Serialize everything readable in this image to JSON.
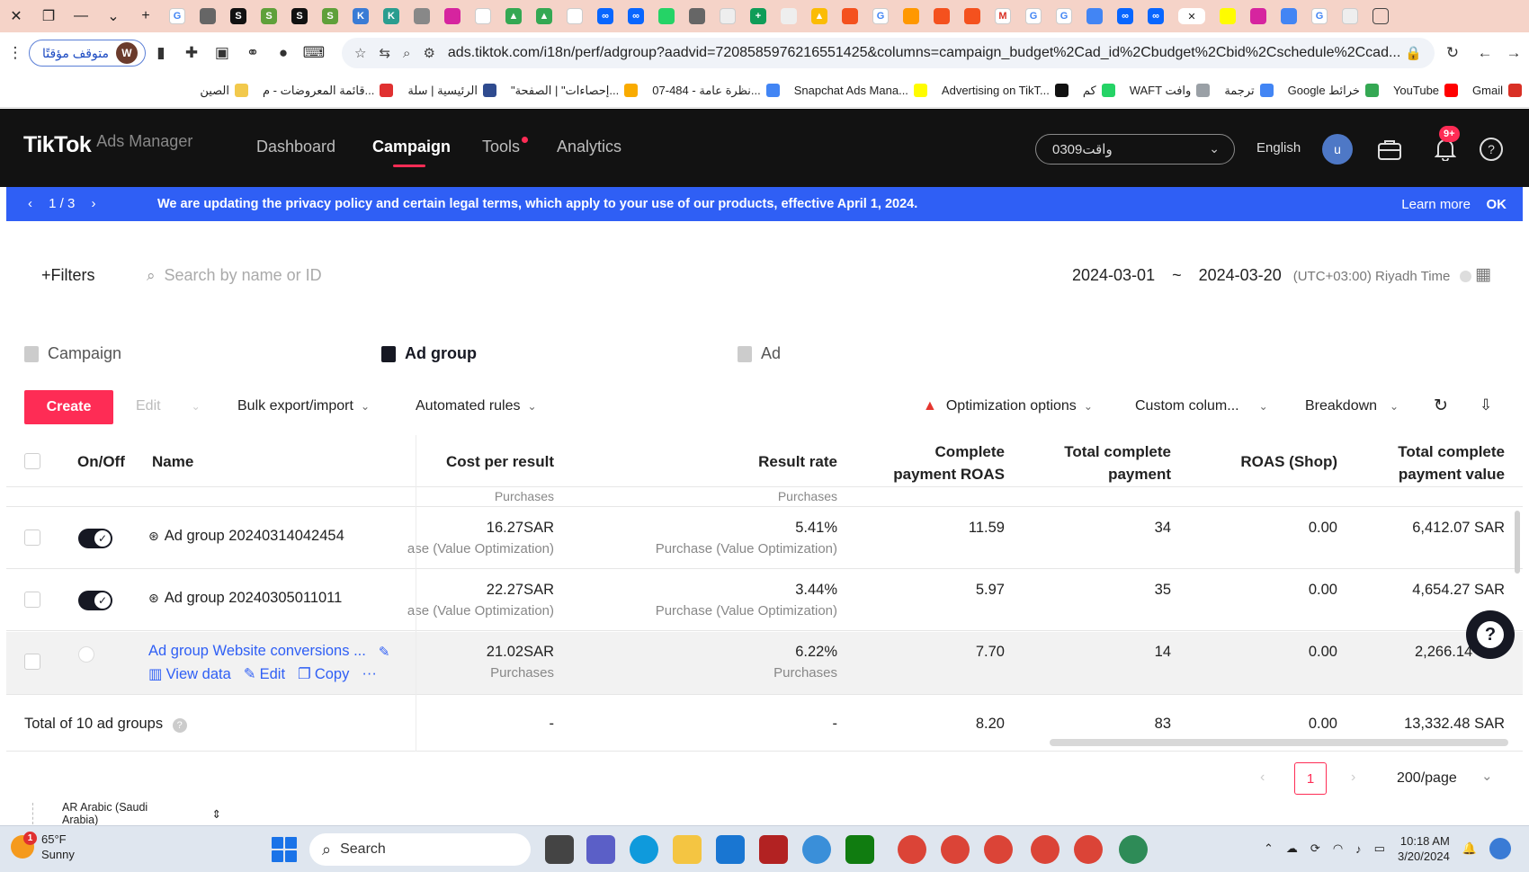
{
  "browser": {
    "window_close": "✕",
    "profile_paused_label": "متوقف مؤقتًا",
    "profile_initial": "W",
    "url": "ads.tiktok.com/i18n/perf/adgroup?aadvid=7208585976216551425&columns=campaign_budget%2Cad_id%2Cbudget%2Cbid%2Cschedule%2Ccad...",
    "bookmarks": [
      {
        "label": "Gmail",
        "icon": "gmail-icon",
        "color": "#d93025"
      },
      {
        "label": "YouTube",
        "icon": "youtube-icon",
        "color": "#ff0000"
      },
      {
        "label": "Google خرائط",
        "icon": "maps-icon",
        "color": "#34a853"
      },
      {
        "label": "ترجمة",
        "icon": "translate-icon",
        "color": "#4285f4"
      },
      {
        "label": "WAFT وافت",
        "icon": "waft-icon",
        "color": "#9aa0a6"
      },
      {
        "label": "كم",
        "icon": "whatsapp-icon",
        "color": "#25d366"
      },
      {
        "label": "Advertising on TikT...",
        "icon": "tiktok-icon",
        "color": "#111111"
      },
      {
        "label": "Snapchat Ads Mana...",
        "icon": "snapchat-icon",
        "color": "#fffc00"
      },
      {
        "label": "نظرة عامة - 484-07...",
        "icon": "google-icon",
        "color": "#4285f4"
      },
      {
        "label": "\"إحصاءات\" | الصفحة...",
        "icon": "analytics-icon",
        "color": "#f9ab00"
      },
      {
        "label": "الرئيسية | سلة",
        "icon": "salla-icon",
        "color": "#2f4b8f"
      },
      {
        "label": "قائمة المعروضات - م...",
        "icon": "flower-icon",
        "color": "#e03030"
      },
      {
        "label": "الصين",
        "icon": "folder-icon",
        "color": "#f2c94c"
      }
    ]
  },
  "header": {
    "logo": "TikTok",
    "logo_sub": "Ads Manager",
    "nav": [
      "Dashboard",
      "Campaign",
      "Tools",
      "Analytics"
    ],
    "account": "واقت0309",
    "language": "English",
    "avatar_initial": "u",
    "notification_badge": "9+"
  },
  "announcement": {
    "pager": "1  /  3",
    "message": "We are updating the privacy policy and certain legal terms, which apply to your use of our products, effective April 1, 2024.",
    "learn_more": "Learn more",
    "ok": "OK"
  },
  "toolbar": {
    "filters": "+Filters",
    "search_placeholder": "Search by name or ID",
    "date_start": "2024-03-01",
    "date_sep": "~",
    "date_end": "2024-03-20",
    "timezone": "(UTC+03:00) Riyadh Time"
  },
  "levels": {
    "campaign": "Campaign",
    "adgroup": "Ad group",
    "ad": "Ad"
  },
  "actions": {
    "create": "Create",
    "edit": "Edit",
    "bulk": "Bulk export/import",
    "rules": "Automated rules",
    "optimization": "Optimization options",
    "custom_columns": "Custom colum...",
    "breakdown": "Breakdown"
  },
  "table": {
    "headers": {
      "onoff": "On/Off",
      "name": "Name",
      "cpr": "Cost per result",
      "rate": "Result rate",
      "roas_line1": "Complete",
      "roas_line2": "payment ROAS",
      "tcp_line1": "Total complete",
      "tcp_line2": "payment",
      "shop": "ROAS (Shop)",
      "value_line1": "Total complete",
      "value_line2": "payment value"
    },
    "ghost_sub": "Purchases",
    "rows": [
      {
        "name": "Ad group 20240314042454",
        "enabled": true,
        "cpr": "16.27SAR",
        "cpr_sub": "ase (Value Optimization)",
        "rate": "5.41%",
        "rate_sub": "Purchase (Value Optimization)",
        "roas": "11.59",
        "tcp": "34",
        "shop": "0.00",
        "value": "6,412.07 SAR"
      },
      {
        "name": "Ad group 20240305011011",
        "enabled": true,
        "cpr": "22.27SAR",
        "cpr_sub": "ase (Value Optimization)",
        "rate": "3.44%",
        "rate_sub": "Purchase (Value Optimization)",
        "roas": "5.97",
        "tcp": "35",
        "shop": "0.00",
        "value": "4,654.27 SAR"
      },
      {
        "name": "Ad group Website conversions ...",
        "enabled": false,
        "cpr": "21.02SAR",
        "cpr_sub": "Purchases",
        "rate": "6.22%",
        "rate_sub": "Purchases",
        "roas": "7.70",
        "tcp": "14",
        "shop": "0.00",
        "value": "2,266.14",
        "row_actions": [
          "View data",
          "Edit",
          "Copy",
          "···"
        ]
      }
    ],
    "total": {
      "label": "Total of 10 ad groups",
      "cpr": "-",
      "rate": "-",
      "roas": "8.20",
      "tcp": "83",
      "shop": "0.00",
      "value": "13,332.48 SAR"
    }
  },
  "pagination": {
    "current": "1",
    "page_size": "200/page"
  },
  "footer_lang": "AR Arabic (Saudi Arabia)",
  "taskbar": {
    "temp": "65°F",
    "weather": "Sunny",
    "weather_badge": "1",
    "search": "Search",
    "time": "10:18 AM",
    "date": "3/20/2024"
  }
}
